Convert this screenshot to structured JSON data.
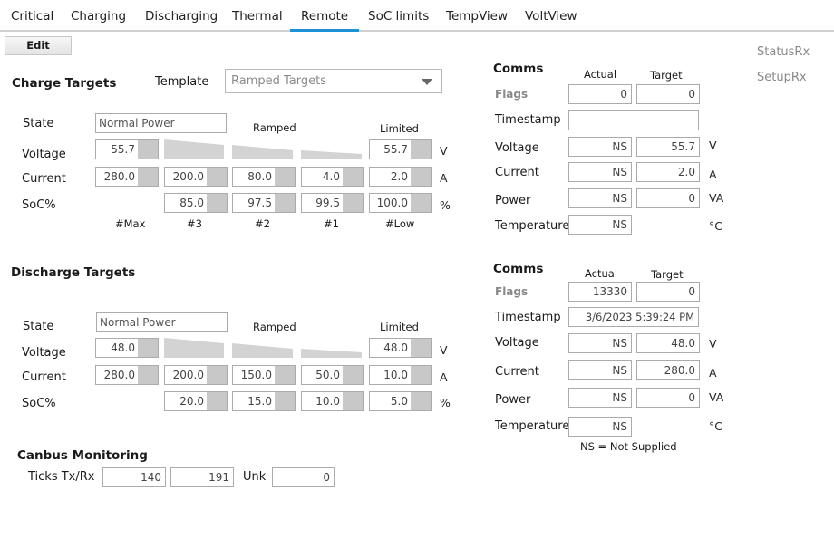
{
  "tabs": [
    "Critical",
    "Charging",
    "Discharging",
    "Thermal",
    "Remote",
    "SoC limits",
    "TempView",
    "VoltView"
  ],
  "toolbar": {
    "edit_label": "Edit"
  },
  "side": {
    "status_rx": "StatusRx",
    "setup_rx": "SetupRx"
  },
  "charge": {
    "title": "Charge Targets",
    "template_label": "Template",
    "template_value": "Ramped Targets",
    "state_label": "State",
    "state_value": "Normal Power",
    "ramped_label": "Ramped",
    "limited_label": "Limited",
    "row_labels": [
      "Voltage",
      "Current",
      "SoC%"
    ],
    "units": [
      "V",
      "A",
      "%"
    ],
    "voltage": {
      "max": "55.7",
      "limited": "55.7"
    },
    "current": [
      "280.0",
      "200.0",
      "80.0",
      "4.0",
      "2.0"
    ],
    "soc": [
      "85.0",
      "97.5",
      "99.5",
      "100.0"
    ],
    "columns": [
      "#Max",
      "#3",
      "#2",
      "#1",
      "#Low"
    ]
  },
  "discharge": {
    "title": "Discharge Targets",
    "state_label": "State",
    "state_value": "Normal Power",
    "ramped_label": "Ramped",
    "limited_label": "Limited",
    "row_labels": [
      "Voltage",
      "Current",
      "SoC%"
    ],
    "units": [
      "V",
      "A",
      "%"
    ],
    "voltage": {
      "max": "48.0",
      "limited": "48.0"
    },
    "current": [
      "280.0",
      "200.0",
      "150.0",
      "50.0",
      "10.0"
    ],
    "soc": [
      "20.0",
      "15.0",
      "10.0",
      "5.0"
    ]
  },
  "comms1": {
    "title": "Comms",
    "actual_label": "Actual",
    "target_label": "Target",
    "rows": [
      "Flags",
      "Timestamp",
      "Voltage",
      "Current",
      "Power",
      "Temperature"
    ],
    "flags": [
      "0",
      "0"
    ],
    "timestamp": "",
    "voltage": [
      "NS",
      "55.7"
    ],
    "current": [
      "NS",
      "2.0"
    ],
    "power": [
      "NS",
      "0"
    ],
    "temperature": "NS",
    "units": [
      "V",
      "A",
      "VA",
      "°C"
    ]
  },
  "comms2": {
    "title": "Comms",
    "actual_label": "Actual",
    "target_label": "Target",
    "rows": [
      "Flags",
      "Timestamp",
      "Voltage",
      "Current",
      "Power",
      "Temperature"
    ],
    "flags": [
      "13330",
      "0"
    ],
    "timestamp": "3/6/2023 5:39:24 PM",
    "voltage": [
      "NS",
      "48.0"
    ],
    "current": [
      "NS",
      "280.0"
    ],
    "power": [
      "NS",
      "0"
    ],
    "temperature": "NS",
    "units": [
      "V",
      "A",
      "VA",
      "°C"
    ],
    "note": "NS = Not Supplied"
  },
  "canbus": {
    "title": "Canbus Monitoring",
    "ticks_label": "Ticks Tx/Rx",
    "tx": "140",
    "rx": "191",
    "unk_label": "Unk",
    "unk": "0"
  }
}
